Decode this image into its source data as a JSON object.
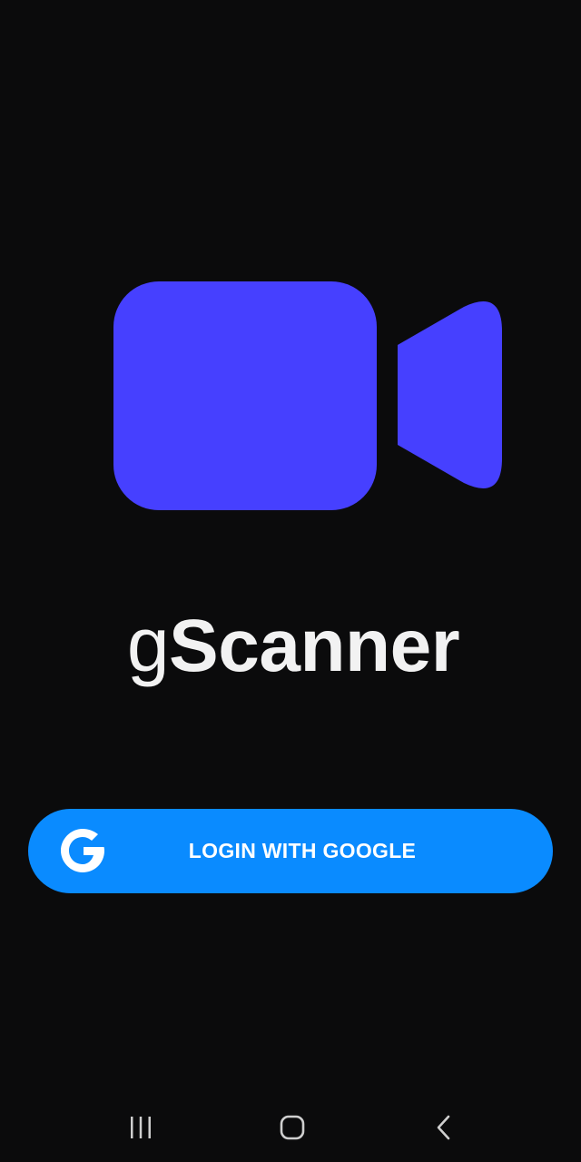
{
  "app": {
    "logo_icon": "video-camera-icon",
    "brand_prefix": "g",
    "brand_main": "Scanner",
    "accent_color": "#4640ff"
  },
  "login": {
    "label": "LOGIN WITH GOOGLE",
    "icon": "google-g-icon",
    "button_color": "#0a8bff"
  },
  "navigation_bar": {
    "recents_icon": "recent-apps-icon",
    "home_icon": "home-icon",
    "back_icon": "back-icon"
  }
}
